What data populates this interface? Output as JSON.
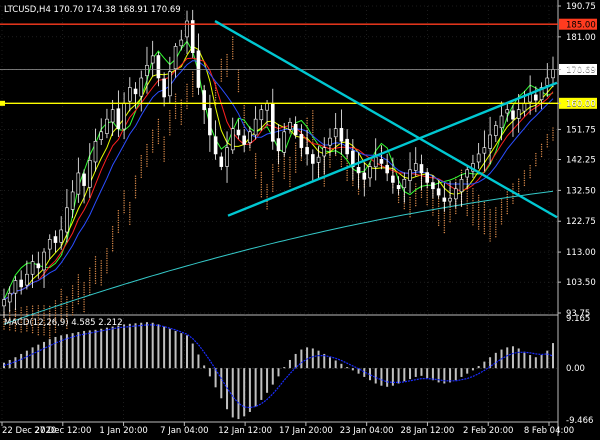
{
  "window": {
    "title": "LTCUSD,H4  170.70 174.38 168.91 170.69",
    "indicator_title": "MACD(12,26,9) 4.585 2.212"
  },
  "colors": {
    "background": "#000000",
    "grid": "#3a3a3a",
    "axis_text": "#ffffff",
    "bull_candle": "#ffffff",
    "bear_candle": "#ffffff",
    "trendline": "#00c8d2",
    "resistance": "#ff3b1f",
    "support_yellow": "#ffff00",
    "current_price_line": "#9a9a9a",
    "ma_red": "#ff2020",
    "ma_blue": "#2b4dff",
    "ma_green": "#33ff33",
    "ma_yellow": "#e6ff00",
    "ichimoku_cloud": "#d98a4a",
    "long_ma": "#35c9c9",
    "macd_hist": "#c0c0c0",
    "macd_signal": "#1a2cff"
  },
  "chart_data": [
    {
      "type": "candlestick",
      "title": "LTCUSD,H4",
      "ohlc_header": {
        "open": 170.7,
        "high": 174.38,
        "low": 168.91,
        "close": 170.69
      },
      "ylim": [
        93.75,
        190.75
      ],
      "y_ticks": [
        "190.75",
        "181.00",
        "170.69",
        "160.00",
        "151.75",
        "142.25",
        "132.50",
        "122.75",
        "113.00",
        "103.50",
        "93.75"
      ],
      "x_ticks": [
        "22 Dec 2020",
        "27 Dec 12:00",
        "1 Jan 20:00",
        "7 Jan 04:00",
        "12 Jan 12:00",
        "17 Jan 20:00",
        "23 Jan 04:00",
        "28 Jan 12:00",
        "2 Feb 20:00",
        "8 Feb 04:00"
      ],
      "current_price": 170.69,
      "horizontal_levels": [
        {
          "value": 185.0,
          "label": "185.00",
          "color": "#ff3b1f"
        },
        {
          "value": 160.0,
          "label": "160.00",
          "color": "#ffff00"
        }
      ],
      "trendlines": [
        {
          "from": [
            "7 Jan 04:00",
            186.0
          ],
          "to": [
            "8 Feb 04:00",
            124.0
          ]
        },
        {
          "from": [
            "8 Jan 12:00",
            124.5
          ],
          "to": [
            "8 Feb 20:00",
            166.5
          ]
        }
      ],
      "series": [
        {
          "close": [
            98,
            100,
            104,
            102,
            106,
            110,
            108,
            113,
            117,
            116,
            120,
            127,
            132,
            138,
            134,
            142,
            148,
            151,
            155,
            158,
            152,
            160,
            165,
            163,
            168,
            172,
            175,
            168,
            162,
            170,
            178,
            180,
            186,
            176,
            165,
            158,
            150,
            144,
            140,
            146,
            152,
            150,
            147,
            151,
            155,
            158,
            160,
            148,
            145,
            151,
            154,
            150,
            146,
            144,
            141,
            143,
            146,
            149,
            152,
            148,
            144,
            140,
            138,
            136,
            140,
            143,
            141,
            138,
            135,
            133,
            136,
            139,
            141,
            138,
            135,
            133,
            131,
            129,
            130,
            133,
            136,
            139,
            141,
            144,
            146,
            150,
            153,
            156,
            158,
            155,
            158,
            160,
            163,
            161,
            165,
            168,
            170.69
          ]
        }
      ]
    },
    {
      "type": "bar",
      "title": "MACD(12,26,9) 4.585 2.212",
      "ylim": [
        -9.466,
        9.165
      ],
      "y_ticks": [
        "9.165",
        "0.00",
        "-9.466"
      ],
      "series": [
        {
          "values": [
            1.0,
            1.5,
            2.0,
            2.6,
            3.2,
            3.8,
            4.3,
            4.8,
            5.3,
            5.7,
            6.0,
            6.2,
            6.4,
            6.6,
            6.8,
            6.9,
            7.0,
            7.2,
            7.4,
            7.6,
            7.8,
            8.0,
            8.1,
            8.2,
            8.3,
            8.4,
            8.3,
            8.0,
            7.6,
            7.2,
            6.8,
            6.4,
            6.0,
            4.5,
            2.5,
            0.5,
            -1.5,
            -3.5,
            -5.5,
            -7.5,
            -9.0,
            -9.3,
            -8.8,
            -8.0,
            -7.0,
            -5.8,
            -4.5,
            -3.0,
            -1.5,
            0.2,
            1.5,
            2.6,
            3.4,
            3.8,
            3.6,
            3.2,
            2.6,
            2.0,
            1.4,
            0.8,
            0.2,
            -0.4,
            -1.0,
            -1.6,
            -2.2,
            -2.8,
            -3.2,
            -3.4,
            -3.2,
            -2.8,
            -2.4,
            -2.0,
            -1.6,
            -1.4,
            -1.8,
            -2.2,
            -2.6,
            -2.8,
            -2.6,
            -2.2,
            -1.6,
            -1.0,
            -0.4,
            0.4,
            1.2,
            2.0,
            2.8,
            3.4,
            3.8,
            4.0,
            3.6,
            3.0,
            2.4,
            2.0,
            2.4,
            3.2,
            4.585
          ]
        },
        {
          "values": [
            0.5,
            0.8,
            1.2,
            1.6,
            2.1,
            2.6,
            3.1,
            3.6,
            4.1,
            4.6,
            5.0,
            5.4,
            5.7,
            6.0,
            6.2,
            6.4,
            6.6,
            6.8,
            7.0,
            7.2,
            7.4,
            7.5,
            7.6,
            7.7,
            7.8,
            7.9,
            7.9,
            7.8,
            7.6,
            7.3,
            7.0,
            6.6,
            6.2,
            5.4,
            4.3,
            2.9,
            1.4,
            -0.2,
            -1.9,
            -3.6,
            -5.2,
            -6.4,
            -7.1,
            -7.2,
            -7.0,
            -6.5,
            -5.7,
            -4.7,
            -3.5,
            -2.2,
            -1.0,
            0.1,
            1.0,
            1.7,
            2.1,
            2.3,
            2.3,
            2.1,
            1.8,
            1.4,
            0.9,
            0.4,
            -0.1,
            -0.7,
            -1.2,
            -1.7,
            -2.1,
            -2.5,
            -2.6,
            -2.6,
            -2.5,
            -2.3,
            -2.1,
            -1.9,
            -1.9,
            -2.0,
            -2.1,
            -2.3,
            -2.3,
            -2.3,
            -2.1,
            -1.9,
            -1.5,
            -1.0,
            -0.4,
            0.3,
            1.0,
            1.7,
            2.3,
            2.7,
            2.9,
            2.9,
            2.8,
            2.6,
            2.5,
            2.6,
            2.212
          ]
        }
      ]
    }
  ]
}
